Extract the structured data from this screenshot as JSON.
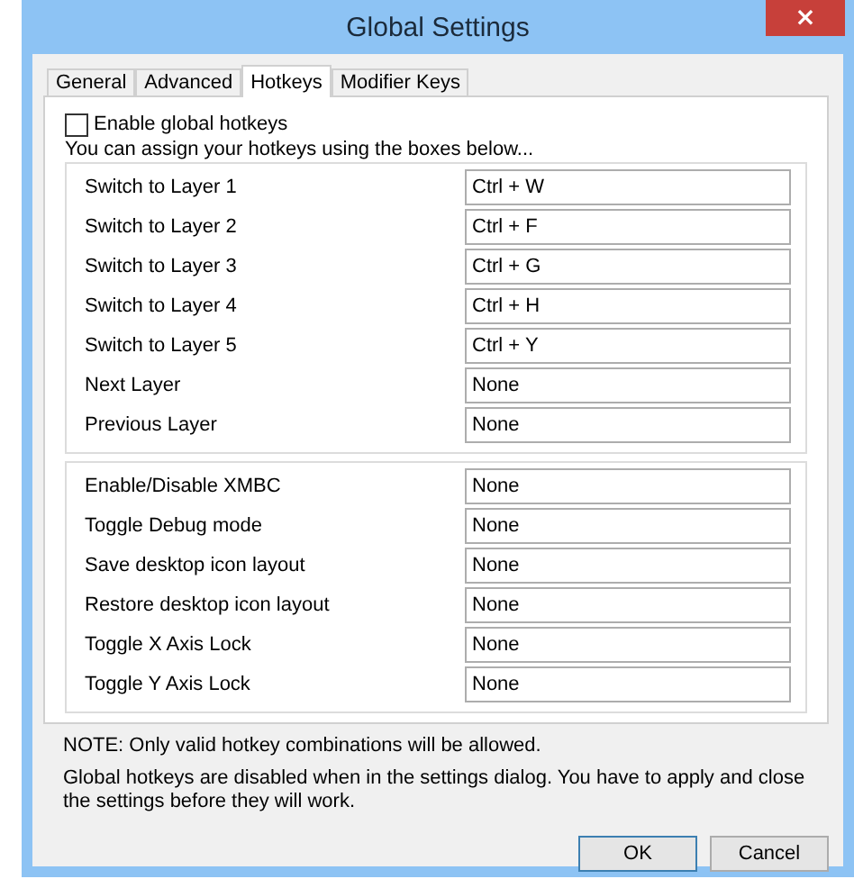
{
  "window": {
    "title": "Global Settings",
    "close": "×"
  },
  "tabs": [
    {
      "label": "General",
      "selected": false
    },
    {
      "label": "Advanced",
      "selected": false
    },
    {
      "label": "Hotkeys",
      "selected": true
    },
    {
      "label": "Modifier Keys",
      "selected": false
    }
  ],
  "enable_global_hotkeys": {
    "label": "Enable global hotkeys",
    "checked": false
  },
  "intro": "You can assign your hotkeys using the boxes below...",
  "hotkey_groups": [
    {
      "rows": [
        {
          "label": "Switch to Layer 1",
          "value": "Ctrl + W"
        },
        {
          "label": "Switch to Layer 2",
          "value": "Ctrl + F"
        },
        {
          "label": "Switch to Layer 3",
          "value": "Ctrl + G"
        },
        {
          "label": "Switch to Layer 4",
          "value": "Ctrl + H"
        },
        {
          "label": "Switch to Layer 5",
          "value": "Ctrl + Y"
        },
        {
          "label": "Next Layer",
          "value": "None"
        },
        {
          "label": "Previous Layer",
          "value": "None"
        }
      ]
    },
    {
      "rows": [
        {
          "label": "Enable/Disable XMBC",
          "value": "None"
        },
        {
          "label": "Toggle Debug mode",
          "value": "None"
        },
        {
          "label": "Save desktop icon layout",
          "value": "None"
        },
        {
          "label": "Restore desktop icon layout",
          "value": "None"
        },
        {
          "label": "Toggle X Axis Lock",
          "value": "None"
        },
        {
          "label": "Toggle Y Axis Lock",
          "value": "None"
        }
      ]
    }
  ],
  "notes": [
    "NOTE: Only valid hotkey combinations will be allowed.",
    "Global hotkeys are disabled when in the settings dialog. You have to apply and close the settings before they will work."
  ],
  "buttons": [
    {
      "label": "OK",
      "kind": "default"
    },
    {
      "label": "Cancel",
      "kind": "normal"
    }
  ]
}
